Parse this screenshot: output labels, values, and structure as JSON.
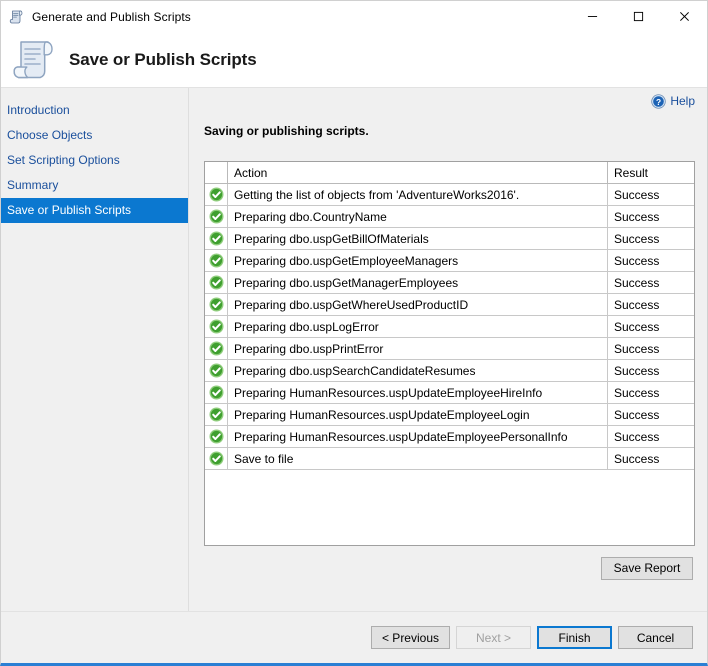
{
  "window": {
    "title": "Generate and Publish Scripts",
    "icon": "script-scroll-icon",
    "controls": {
      "minimize": "minimize-icon",
      "maximize": "maximize-icon",
      "close": "close-icon"
    },
    "accent_color": "#0b78d0",
    "bottom_border_color": "#2a7fd4"
  },
  "header": {
    "title": "Save or Publish Scripts",
    "icon": "script-scroll-icon"
  },
  "sidebar": {
    "items": [
      {
        "label": "Introduction",
        "selected": false
      },
      {
        "label": "Choose Objects",
        "selected": false
      },
      {
        "label": "Set Scripting Options",
        "selected": false
      },
      {
        "label": "Summary",
        "selected": false
      },
      {
        "label": "Save or Publish Scripts",
        "selected": true
      }
    ],
    "link_color": "#1a4f9c",
    "selected_color": "#0b78d0"
  },
  "content": {
    "help_label": "Help",
    "help_icon": "help-circle-icon",
    "status_text": "Saving or publishing scripts.",
    "save_report_label": "Save Report"
  },
  "grid": {
    "columns": [
      "",
      "Action",
      "Result"
    ],
    "status_icon": "success-check-icon",
    "status_color": "#3f9f2f",
    "rows": [
      {
        "action": "Getting the list of objects from 'AdventureWorks2016'.",
        "result": "Success"
      },
      {
        "action": "Preparing dbo.CountryName",
        "result": "Success"
      },
      {
        "action": "Preparing dbo.uspGetBillOfMaterials",
        "result": "Success"
      },
      {
        "action": "Preparing dbo.uspGetEmployeeManagers",
        "result": "Success"
      },
      {
        "action": "Preparing dbo.uspGetManagerEmployees",
        "result": "Success"
      },
      {
        "action": "Preparing dbo.uspGetWhereUsedProductID",
        "result": "Success"
      },
      {
        "action": "Preparing dbo.uspLogError",
        "result": "Success"
      },
      {
        "action": "Preparing dbo.uspPrintError",
        "result": "Success"
      },
      {
        "action": "Preparing dbo.uspSearchCandidateResumes",
        "result": "Success"
      },
      {
        "action": "Preparing HumanResources.uspUpdateEmployeeHireInfo",
        "result": "Success"
      },
      {
        "action": "Preparing HumanResources.uspUpdateEmployeeLogin",
        "result": "Success"
      },
      {
        "action": "Preparing HumanResources.uspUpdateEmployeePersonalInfo",
        "result": "Success"
      },
      {
        "action": "Save to file",
        "result": "Success"
      }
    ]
  },
  "footer": {
    "previous_label": "< Previous",
    "next_label": "Next >",
    "next_disabled": true,
    "finish_label": "Finish",
    "finish_default": true,
    "cancel_label": "Cancel"
  }
}
